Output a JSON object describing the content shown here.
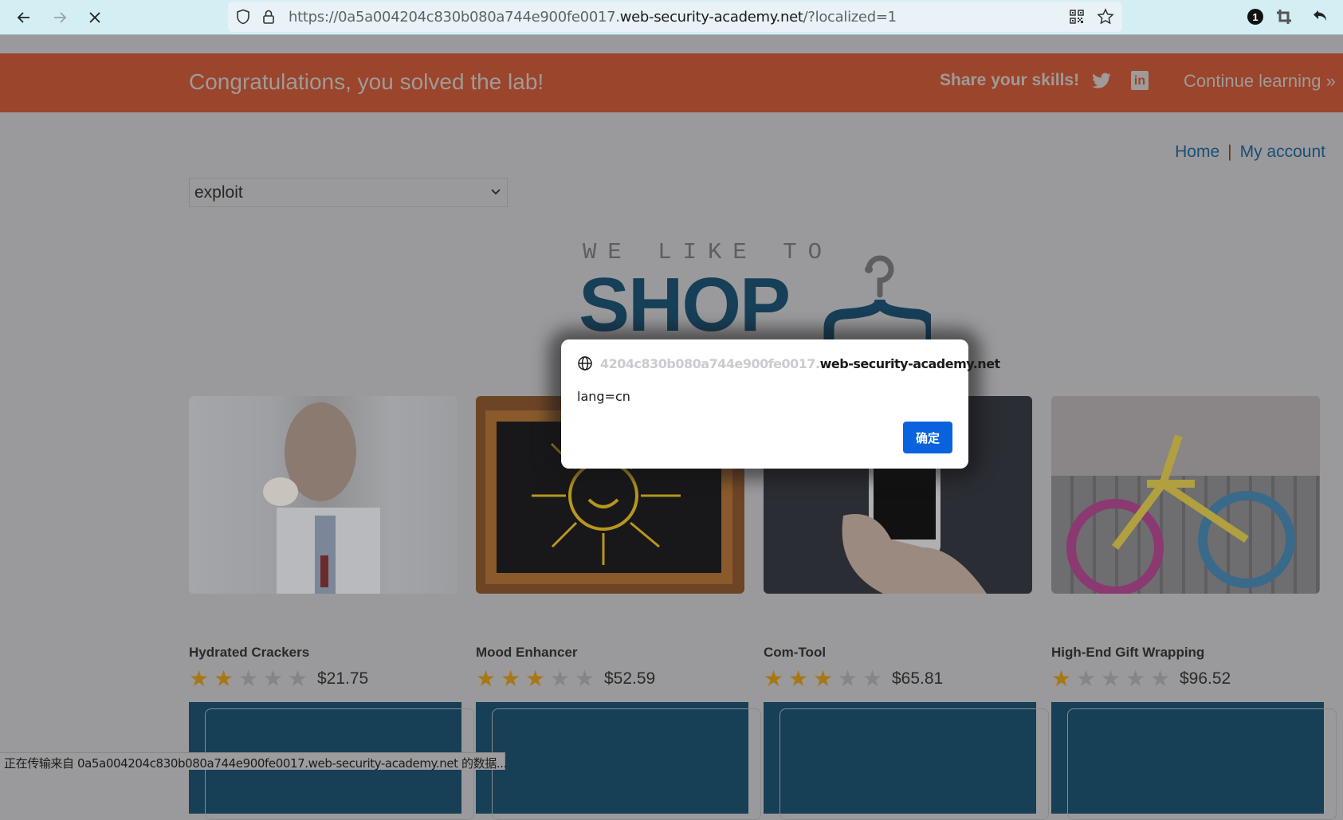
{
  "browser": {
    "url_prefix": "https://0a5a004204c830b080a744e900fe0017.",
    "url_host": "web-security-academy.net",
    "url_suffix": "/?localized=1",
    "badge_count": "1",
    "icons": {
      "back": "arrow-left-icon",
      "forward": "arrow-right-icon",
      "stop": "close-icon",
      "tracking": "shield-icon",
      "lock": "lock-icon",
      "qr": "qr-code-icon",
      "bookmark": "star-outline-icon",
      "extension": "badge-icon",
      "crop": "crop-icon",
      "undo": "undo-icon"
    }
  },
  "banner": {
    "message": "Congratulations, you solved the lab!",
    "share_label": "Share your skills!",
    "continue_label": "Continue learning",
    "continue_chevron": "»",
    "linkedin_label": "in",
    "color": "#9a452c"
  },
  "nav": {
    "home": "Home",
    "separator": "|",
    "my_account": "My account"
  },
  "language_select": {
    "value": "exploit"
  },
  "logo": {
    "line1": "WE LIKE TO",
    "line2": "SHOP"
  },
  "products": [
    {
      "name": "Hydrated Crackers",
      "rating": 2,
      "max_rating": 5,
      "price": "$21.75"
    },
    {
      "name": "Mood Enhancer",
      "rating": 3,
      "max_rating": 5,
      "price": "$52.59"
    },
    {
      "name": "Com-Tool",
      "rating": 3,
      "max_rating": 5,
      "price": "$65.81"
    },
    {
      "name": "High-End Gift Wrapping",
      "rating": 1,
      "max_rating": 5,
      "price": "$96.52"
    }
  ],
  "alert_dialog": {
    "origin_faded": "4204c830b080a744e900fe0017.",
    "origin": "web-security-academy.net",
    "message": "lang=cn",
    "ok_label": "确定",
    "button_color": "#0a63dc"
  },
  "status_bar": {
    "text": "正在传输来自 0a5a004204c830b080a744e900fe0017.web-security-academy.net 的数据..."
  }
}
